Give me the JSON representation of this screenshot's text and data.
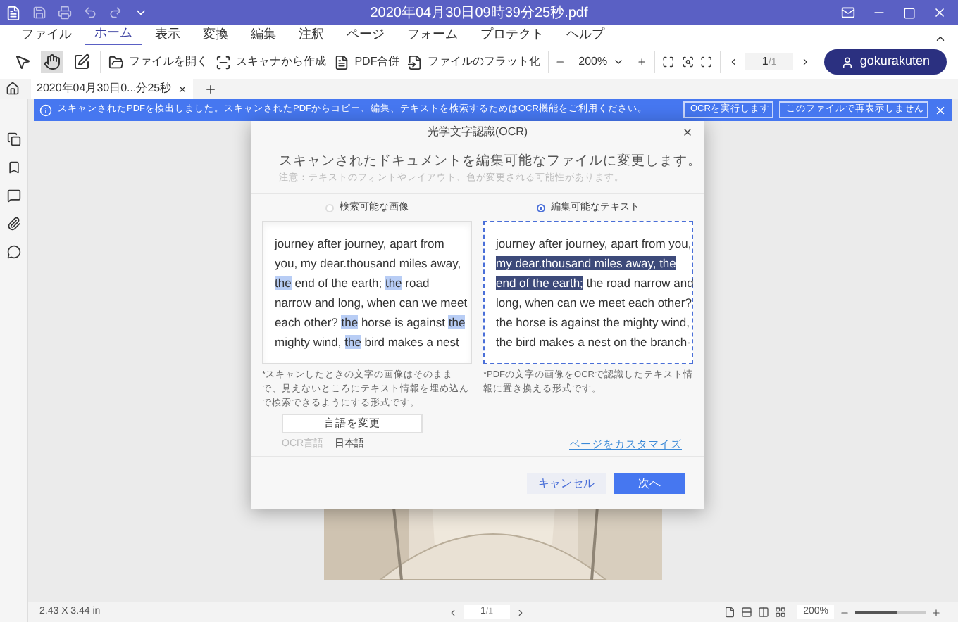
{
  "window": {
    "title": "2020年04月30日09時39分25秒.pdf"
  },
  "menu": [
    {
      "label": "ファイル",
      "selected": false
    },
    {
      "label": "ホーム",
      "selected": true
    },
    {
      "label": "表示",
      "selected": false
    },
    {
      "label": "変換",
      "selected": false
    },
    {
      "label": "編集",
      "selected": false
    },
    {
      "label": "注釈",
      "selected": false
    },
    {
      "label": "ページ",
      "selected": false
    },
    {
      "label": "フォーム",
      "selected": false
    },
    {
      "label": "プロテクト",
      "selected": false
    },
    {
      "label": "ヘルプ",
      "selected": false
    }
  ],
  "toolbar": {
    "tools": [
      {
        "kind": "select",
        "selected": false
      },
      {
        "kind": "hand",
        "selected": true
      },
      {
        "kind": "edit",
        "selected": false
      }
    ],
    "actions": [
      {
        "kind": "open",
        "label": "ファイルを開く"
      },
      {
        "kind": "scan",
        "label": "スキャナから作成"
      },
      {
        "kind": "merge",
        "label": "PDF合併"
      },
      {
        "kind": "flatten",
        "label": "ファイルのフラット化"
      }
    ],
    "zoom": "200%",
    "page": "1",
    "page_total": "/1",
    "user": "gokurakuten"
  },
  "doc_tab": {
    "label": "2020年04月30日0...分25秒"
  },
  "notice": {
    "text": "スキャンされたPDFを検出しました。スキャンされたPDFからコピー、編集、テキストを検索するためはOCR機能をご利用ください。",
    "buttons": [
      "OCRを実行します",
      "このファイルで再表示しません"
    ]
  },
  "dialog": {
    "title": "光学文字認識(OCR)",
    "heading": "スキャンされたドキュメントを編集可能なファイルに変更します。",
    "note": "注意：テキストのフォントやレイアウト、色が変更される可能性があります。",
    "options": [
      {
        "label": "検索可能な画像",
        "selected": false,
        "description": "*スキャンしたときの文字の画像はそのままで、見えないところにテキスト情報を埋め込んで検索できるようにする形式です。",
        "lines": [
          [
            {
              "text": "journey after journey, apart from",
              "mark": false
            }
          ],
          [
            {
              "text": "you, my dear.thousand miles away,",
              "mark": false
            }
          ],
          [
            {
              "text": "the",
              "mark": true
            },
            {
              "text": " end of the earth; ",
              "mark": false
            },
            {
              "text": "the",
              "mark": true
            },
            {
              "text": " road",
              "mark": false
            }
          ],
          [
            {
              "text": "narrow and long, when can we meet",
              "mark": false
            }
          ],
          [
            {
              "text": "each other? ",
              "mark": false
            },
            {
              "text": "the",
              "mark": true
            },
            {
              "text": " horse is against ",
              "mark": false
            },
            {
              "text": "the",
              "mark": true
            }
          ],
          [
            {
              "text": "mighty wind, ",
              "mark": false
            },
            {
              "text": "the",
              "mark": true
            },
            {
              "text": " bird makes a nest",
              "mark": false
            }
          ]
        ]
      },
      {
        "label": "編集可能なテキスト",
        "selected": true,
        "description": "*PDFの文字の画像をOCRで認識したテキスト情報に置き換える形式です。",
        "lines": [
          [
            {
              "text": "journey after journey, apart from you,",
              "mark": false
            }
          ],
          [
            {
              "text": "my dear.thousand miles away, the",
              "mark": true
            }
          ],
          [
            {
              "text": "end of the earth;",
              "mark": true
            },
            {
              "text": " the road narrow and",
              "mark": false
            }
          ],
          [
            {
              "text": "long, when can we meet each other?",
              "mark": false
            }
          ],
          [
            {
              "text": "the horse is against the mighty wind,",
              "mark": false
            }
          ],
          [
            {
              "text": "the bird makes a nest on the branch-",
              "mark": false
            }
          ]
        ]
      }
    ],
    "language_button": "言語を変更",
    "language_label": "OCR言語",
    "language": "日本語",
    "customize_link": "ページをカスタマイズ",
    "cancel": "キャンセル",
    "next": "次へ"
  },
  "status_bar": {
    "size": "2.43 X 3.44 in",
    "page": "1",
    "page_total": "/1",
    "zoom": "200%",
    "level": 0.6
  }
}
